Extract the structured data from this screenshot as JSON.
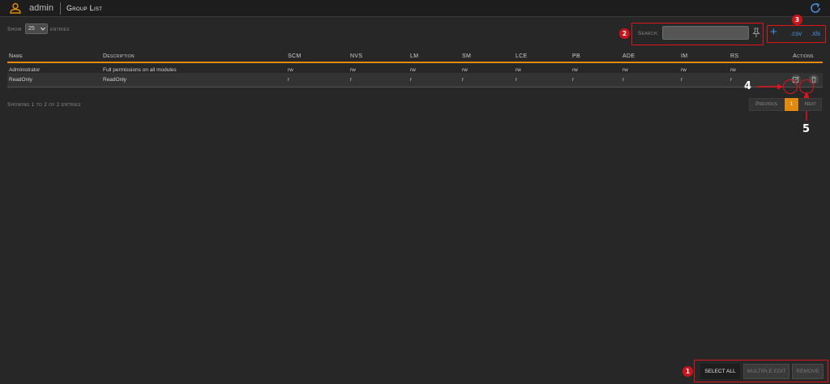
{
  "header": {
    "user_name": "admin",
    "page_title": "Group List"
  },
  "length_control": {
    "show_label": "Show",
    "value": "25",
    "entries_label": "entries"
  },
  "search": {
    "label": "Search:",
    "value": "",
    "placeholder": ""
  },
  "toolbar": {
    "add_label": "+",
    "csv_label": ".csv",
    "xls_label": ".xls"
  },
  "table": {
    "columns": [
      "Name",
      "Description",
      "SCM",
      "NVS",
      "LM",
      "SM",
      "LCE",
      "PB",
      "ADE",
      "IM",
      "RS",
      "Actions"
    ],
    "rows": [
      [
        "Administrator",
        "Full permissions on all modules",
        "rw",
        "rw",
        "rw",
        "rw",
        "rw",
        "rw",
        "rw",
        "rw",
        "rw"
      ],
      [
        "ReadOnly",
        "ReadOnly",
        "r",
        "r",
        "r",
        "r",
        "r",
        "r",
        "r",
        "r",
        "r"
      ]
    ]
  },
  "info": "Showing 1 to 2 of 2 entries",
  "pagination": {
    "previous": "Previous",
    "current": "1",
    "next": "Next"
  },
  "bottom_actions": {
    "select_all": "SELECT ALL",
    "multiple_edit": "MULTIPLE EDIT",
    "remove": "REMOVE"
  },
  "annotations": {
    "badge_1": "1",
    "badge_2": "2",
    "badge_3": "3",
    "label_4": "4",
    "label_5": "5"
  },
  "colors": {
    "accent": "#e08a10",
    "link": "#4a8fe0",
    "annotation": "#e0141c"
  },
  "icons": [
    "user-icon",
    "refresh-icon",
    "chevron-down-icon",
    "pin-icon",
    "edit-icon",
    "trash-icon"
  ]
}
